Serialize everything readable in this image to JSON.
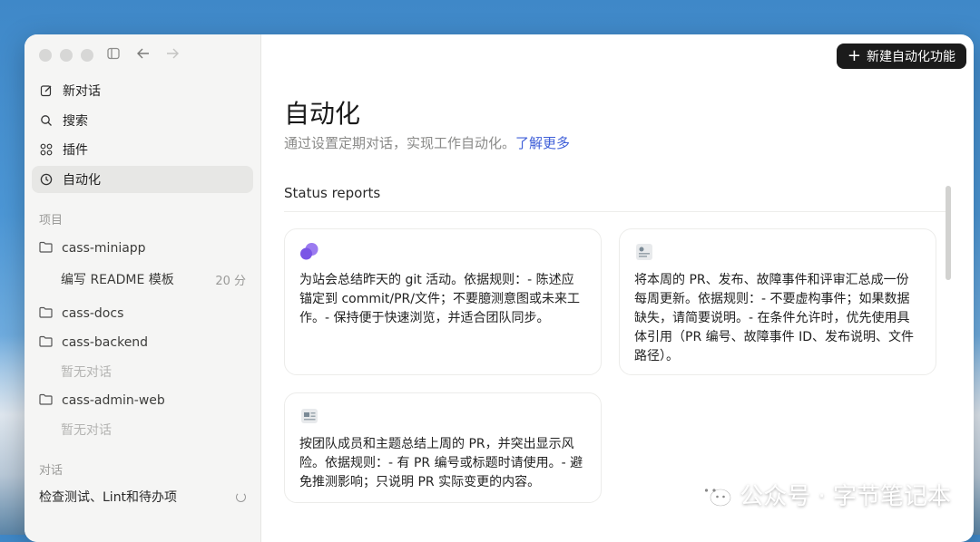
{
  "sidebar": {
    "nav": [
      {
        "label": "新对话",
        "icon": "edit-icon"
      },
      {
        "label": "搜索",
        "icon": "search-icon"
      },
      {
        "label": "插件",
        "icon": "plugins-icon"
      },
      {
        "label": "自动化",
        "icon": "clock-icon"
      }
    ],
    "projects_label": "项目",
    "projects": [
      {
        "name": "cass-miniapp",
        "sub": {
          "label": "编写 README 模板",
          "time": "20 分"
        }
      },
      {
        "name": "cass-docs"
      },
      {
        "name": "cass-backend",
        "empty": "暂无对话"
      },
      {
        "name": "cass-admin-web",
        "empty": "暂无对话"
      }
    ],
    "conversations_label": "对话",
    "conversation": "检查测试、Lint和待办项"
  },
  "main": {
    "new_button": "新建自动化功能",
    "title": "自动化",
    "subtitle": "通过设置定期对话，实现工作自动化。",
    "learn_more": "了解更多",
    "section": "Status reports",
    "cards": [
      {
        "text": "为站会总结昨天的 git 活动。依据规则：- 陈述应锚定到 commit/PR/文件；不要臆测意图或未来工作。- 保持便于快速浏览，并适合团队同步。",
        "icon": "chat-bubbles-icon"
      },
      {
        "text": "将本周的 PR、发布、故障事件和评审汇总成一份每周更新。依据规则：- 不要虚构事件；如果数据缺失，请简要说明。- 在条件允许时，优先使用具体引用（PR 编号、故障事件 ID、发布说明、文件路径）。",
        "icon": "document-person-icon"
      },
      {
        "text": "按团队成员和主题总结上周的 PR，并突出显示风险。依据规则：- 有 PR 编号或标题时请使用。- 避免推测影响；只说明 PR 实际变更的内容。",
        "icon": "newspaper-icon"
      }
    ]
  },
  "watermark": "公众号 · 字节笔记本"
}
